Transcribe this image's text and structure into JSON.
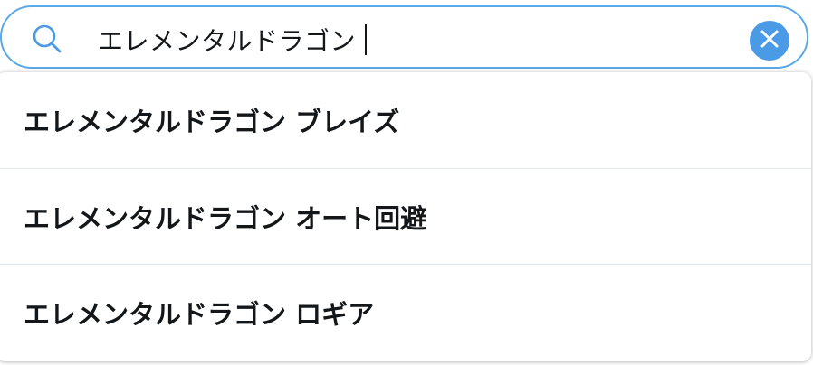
{
  "search": {
    "query": "エレメンタルドラゴン",
    "icon": "search-icon",
    "clear_icon": "close-icon",
    "accent": "#4a9ae6"
  },
  "suggestions": [
    {
      "label": "エレメンタルドラゴン ブレイズ"
    },
    {
      "label": "エレメンタルドラゴン オート回避"
    },
    {
      "label": "エレメンタルドラゴン ロギア"
    }
  ]
}
